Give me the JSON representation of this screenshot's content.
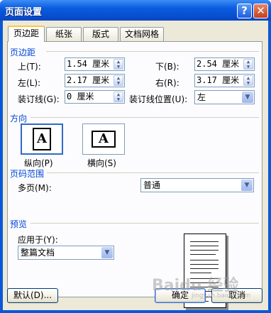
{
  "window": {
    "title": "页面设置",
    "help": "?",
    "close": "✕"
  },
  "tabs": [
    "页边距",
    "纸张",
    "版式",
    "文档网格"
  ],
  "margins": {
    "section": "页边距",
    "top_label": "上(T):",
    "top_value": "1.54 厘米",
    "bottom_label": "下(B):",
    "bottom_value": "2.54 厘米",
    "left_label": "左(L):",
    "left_value": "2.17 厘米",
    "right_label": "右(R):",
    "right_value": "3.17 厘米",
    "gutter_label": "装订线(G):",
    "gutter_value": "0 厘米",
    "gutter_pos_label": "装订线位置(U):",
    "gutter_pos_value": "左"
  },
  "orientation": {
    "section": "方向",
    "portrait": "纵向(P)",
    "landscape": "横向(S)",
    "glyph": "A"
  },
  "pages": {
    "section": "页码范围",
    "multiple_label": "多页(M):",
    "multiple_value": "普通"
  },
  "preview": {
    "section": "预览",
    "apply_label": "应用于(Y):",
    "apply_value": "整篇文档"
  },
  "buttons": {
    "default": "默认(D)...",
    "ok": "确定",
    "cancel": "取消"
  },
  "watermark": {
    "text": "Baidu 经验",
    "sub": "jingyan.baidu.com"
  }
}
